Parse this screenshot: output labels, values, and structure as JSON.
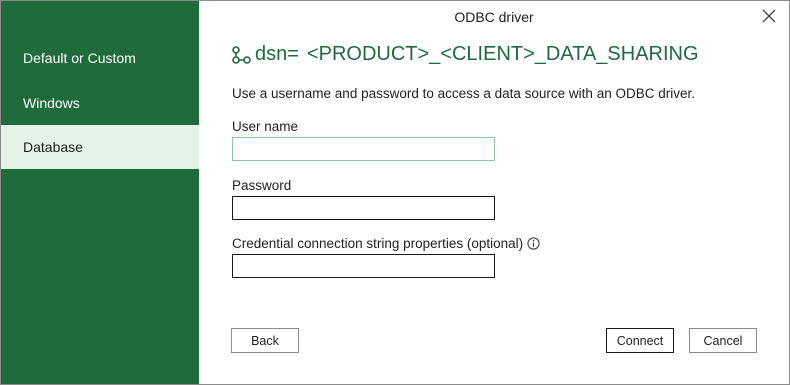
{
  "window": {
    "title": "ODBC driver"
  },
  "sidebar": {
    "items": [
      {
        "label": "Default or Custom",
        "active": false
      },
      {
        "label": "Windows",
        "active": false
      },
      {
        "label": "Database",
        "active": true
      }
    ]
  },
  "main": {
    "heading_prefix": "dsn=",
    "heading_dsn": "<PRODUCT>_<CLIENT>_DATA_SHARING",
    "description": "Use a username and password to access a data source with an ODBC driver.",
    "username": {
      "label": "User name",
      "value": ""
    },
    "password": {
      "label": "Password",
      "value": ""
    },
    "credential": {
      "label": "Credential connection string properties (optional)",
      "value": ""
    }
  },
  "buttons": {
    "back": "Back",
    "connect": "Connect",
    "cancel": "Cancel"
  },
  "colors": {
    "brand_green": "#1f6b3c",
    "active_item_bg": "#e4f2e8",
    "focus_border": "#8cc7a2"
  },
  "icons": {
    "heading": "link-icon",
    "info": "info-icon",
    "close": "close-icon"
  }
}
